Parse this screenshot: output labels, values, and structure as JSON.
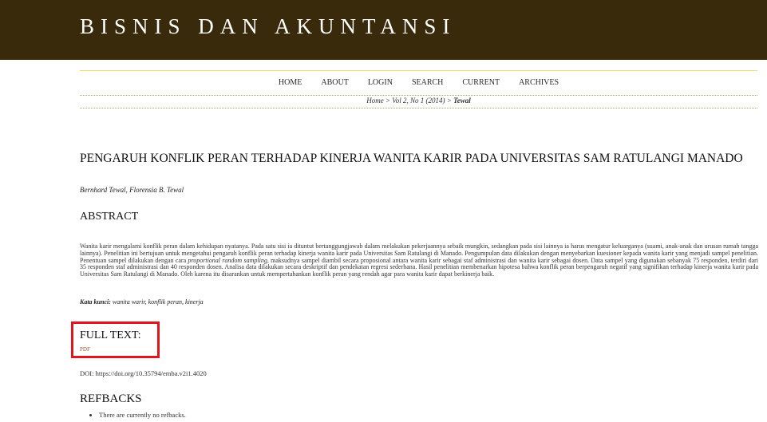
{
  "header": {
    "title": "BISNIS DAN AKUNTANSI"
  },
  "nav": {
    "items": [
      "HOME",
      "ABOUT",
      "LOGIN",
      "SEARCH",
      "CURRENT",
      "ARCHIVES"
    ]
  },
  "breadcrumb": {
    "home": "Home",
    "sep1": " > ",
    "issue": "Vol 2, No 1 (2014)",
    "sep2": " > ",
    "current": "Tewal"
  },
  "article": {
    "title": "PENGARUH KONFLIK PERAN TERHADAP KINERJA WANITA KARIR PADA UNIVERSITAS SAM RATULANGI MANADO",
    "authors": "Bernhard Tewal, Florensia B. Tewal",
    "abstract_heading": "ABSTRACT",
    "abstract_part1": "Wanita karir mengalami konflik peran dalam kehidupan nyatanya. Pada satu sisi ia dituntut bertanggungjawab dalam melakukan pekerjaannya sebaik mungkin, sedangkan pada sisi lainnya ia harus mengatur keluarganya (suami, anak-anak dan urusan rumah tangga lainnya). Penelitian ini bertujuan untuk mengetahui pengaruh konflik peran terhadap kinerja wanita karir pada Universitas Sam Ratulangi di Manado. Pengumpulan data dilakukan dengan menyebarkan kuesioner kepada wanita karir yang menjadi sampel penelitian. Penentuan sampel dilakukan dengan cara ",
    "abstract_italic": "proportional random sampling",
    "abstract_part2": ", maksudnya sampel diambil secara proposional antara wanita karir sebagai staf administrasi dan wanita karir sebagai dosen. Data sampel yang digunakan sebanyak 75 responden, terdiri dari 35 responden staf administrasi dan 40 responden dosen. Analisa data dilakukan secara deskriptif dan pendekatan regresi sederhana. Hasil penelitian membenarkan hipotesa bahwa konflik peran berpengaruh negatif yang signifikan terhadap kinerja wanita karir pada Universitas Sam Ratulangi di Manado. Oleh karena itu disarankan untuk mempertahankan konflik peran yang rendah agar para wanita karir dapat berkinerja baik.",
    "keywords_label": "Kata kunci:",
    "keywords": " wanita warir, konflik peran, kinerja",
    "fulltext_heading": "FULL TEXT:",
    "pdf_label": "PDF",
    "doi": "DOI: https://doi.org/10.35794/emba.v2i1.4020",
    "refbacks_heading": "REFBACKS",
    "refbacks_items": [
      "There are currently no refbacks."
    ]
  },
  "colors": {
    "header_bg": "#3a2a0c",
    "highlight_box": "#e0161e",
    "nav_rule": "#e8e26a"
  }
}
